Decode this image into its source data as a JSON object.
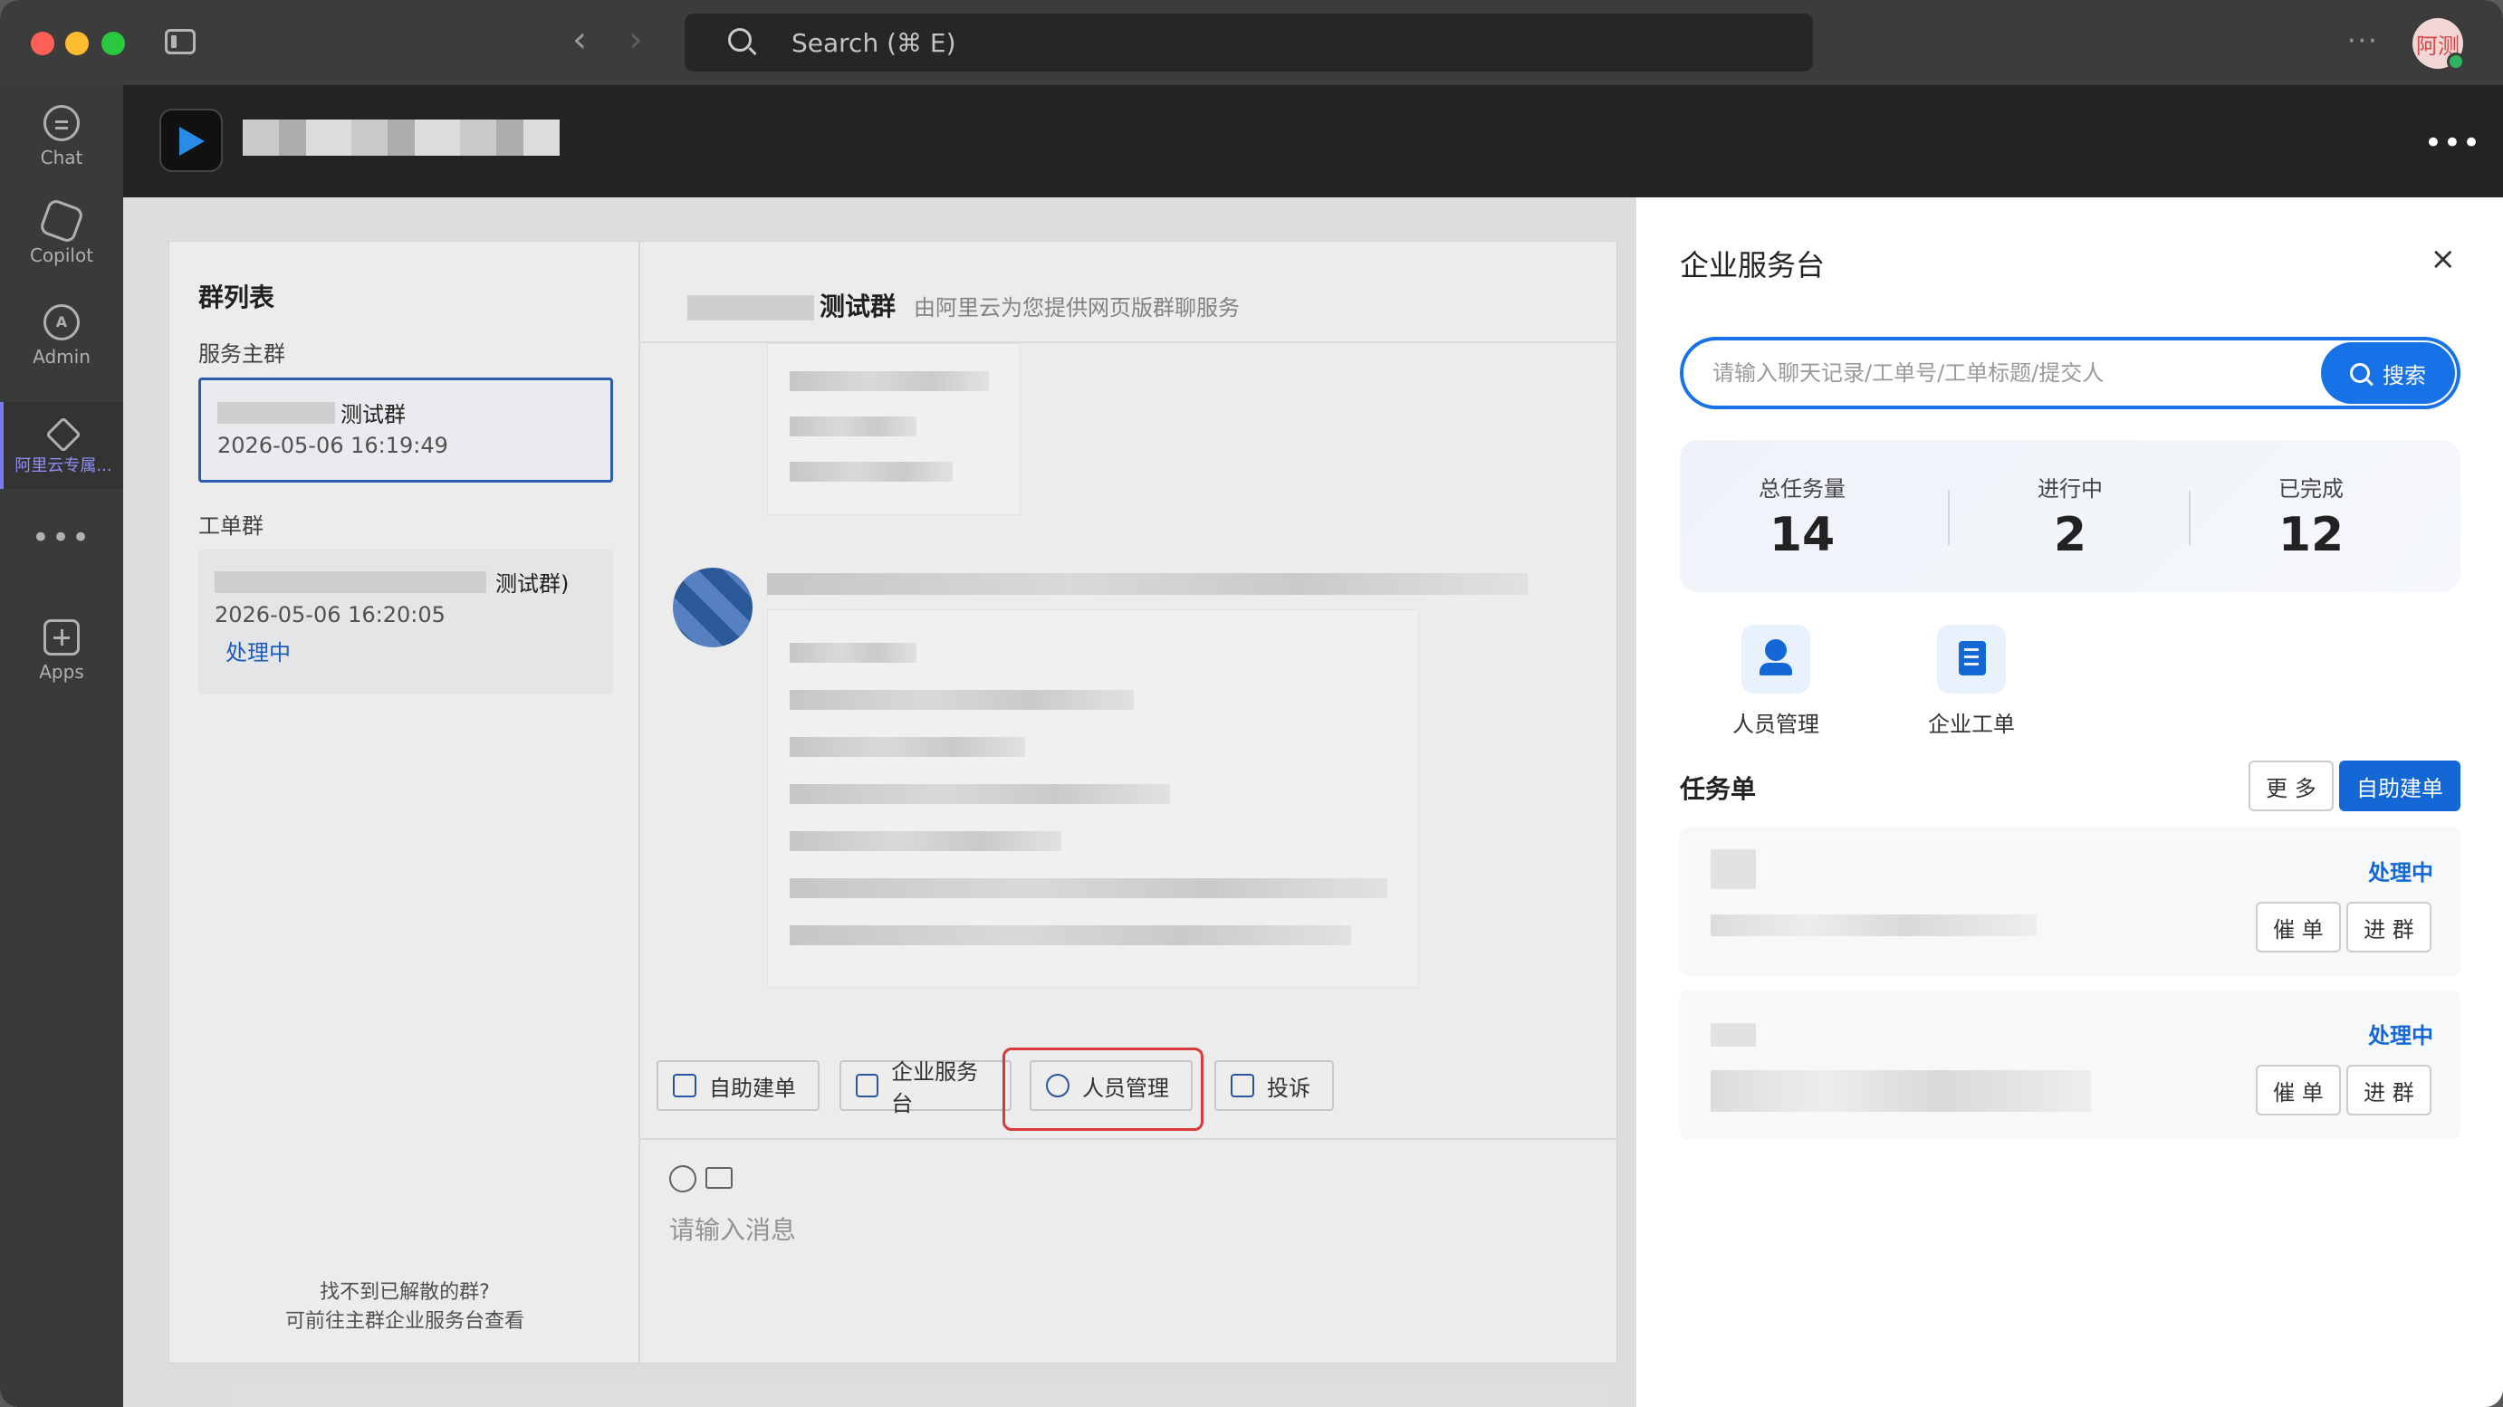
{
  "titlebar": {
    "search_placeholder": "Search (⌘ E)",
    "avatar_text": "阿测"
  },
  "rail": {
    "items": [
      {
        "label": "Chat",
        "icon": "chat-icon"
      },
      {
        "label": "Copilot",
        "icon": "copilot-icon"
      },
      {
        "label": "Admin",
        "icon": "admin-icon"
      },
      {
        "label": "阿里云专属...",
        "icon": "aliyun-icon"
      },
      {
        "label": "•••",
        "icon": "more-icon"
      },
      {
        "label": "Apps",
        "icon": "apps-icon"
      }
    ]
  },
  "app_header": {
    "more": "•••"
  },
  "group_list": {
    "title": "群列表",
    "main_section": "服务主群",
    "main_group": {
      "name": "测试群",
      "time": "2026-05-06 16:19:49"
    },
    "ticket_section": "工单群",
    "ticket_group": {
      "name": "测试群)",
      "time": "2026-05-06 16:20:05",
      "status": "处理中"
    },
    "footer_line1": "找不到已解散的群?",
    "footer_line2": "可前往主群企业服务台查看"
  },
  "chat": {
    "title": "测试群",
    "subtitle": "由阿里云为您提供网页版群聊服务",
    "quick_actions": [
      "自助建单",
      "企业服务台",
      "人员管理",
      "投诉"
    ],
    "input_placeholder": "请输入消息"
  },
  "drawer": {
    "title": "企业服务台",
    "close": "×",
    "search_placeholder": "请输入聊天记录/工单号/工单标题/提交人",
    "search_button": "搜索",
    "stats": [
      {
        "label": "总任务量",
        "value": "14"
      },
      {
        "label": "进行中",
        "value": "2"
      },
      {
        "label": "已完成",
        "value": "12"
      }
    ],
    "shortcuts": [
      {
        "label": "人员管理",
        "icon": "person-icon"
      },
      {
        "label": "企业工单",
        "icon": "ticket-doc-icon"
      }
    ],
    "tasks_title": "任务单",
    "more_button": "更 多",
    "create_button": "自助建单",
    "tasks": [
      {
        "status": "处理中",
        "remind": "催 单",
        "join": "进 群"
      },
      {
        "status": "处理中",
        "remind": "催 单",
        "join": "进 群"
      }
    ]
  },
  "colors": {
    "accent": "#1468d6",
    "highlight": "#e23c3c",
    "status": "#1468d6"
  }
}
